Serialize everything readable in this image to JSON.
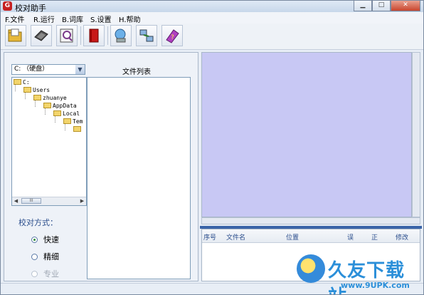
{
  "window": {
    "title": "校对助手",
    "close_glyph": "✕",
    "minimize_glyph": "▁",
    "maximize_glyph": "□"
  },
  "menu": [
    "F.文件",
    "R.运行",
    "B.词库",
    "S.设置",
    "H.帮助"
  ],
  "toolbar": {
    "buttons": [
      "open-folder-icon",
      "disk-icon",
      "search-doc-icon",
      "book-icon",
      "network-icon",
      "connect-icon",
      "help-book-icon"
    ]
  },
  "left": {
    "drive": "C: （硬盘）",
    "filelist_header": "文件列表",
    "tree": [
      "C:",
      "Users",
      "zhuanye",
      "AppData",
      "Local",
      "Tem",
      ""
    ],
    "scroll_thumb": "III"
  },
  "mode": {
    "label": "校对方式：",
    "options": [
      {
        "label": "快速",
        "selected": true,
        "enabled": true
      },
      {
        "label": "精细",
        "selected": false,
        "enabled": true
      },
      {
        "label": "专业",
        "selected": false,
        "enabled": false
      }
    ]
  },
  "results": {
    "columns": [
      "序号",
      "文件名",
      "位置",
      "误",
      "正",
      "修改"
    ]
  },
  "watermark": {
    "main": "久友下载站",
    "sub": "www.9UPK.com"
  },
  "colors": {
    "preview_bg": "#c8c8f4",
    "splitter": "#3a64a8",
    "header_text": "#2a4d8c"
  }
}
